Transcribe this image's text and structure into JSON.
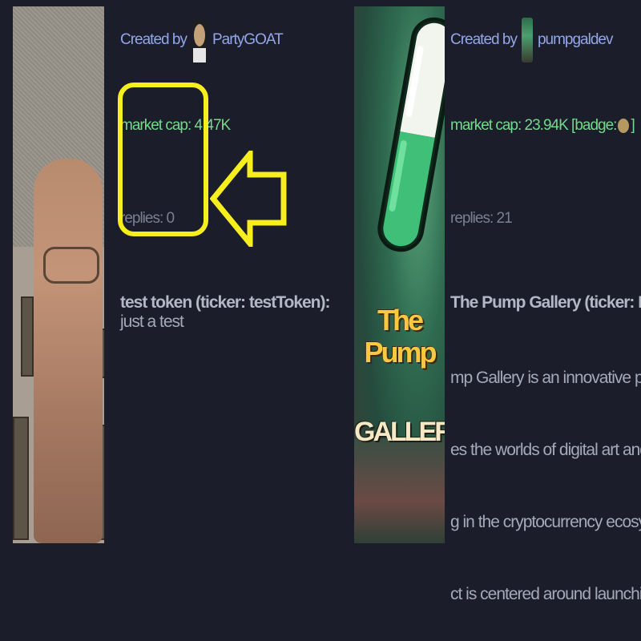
{
  "card1": {
    "created_label": "Created by",
    "creator": "PartyGOAT",
    "market_cap": "market cap: 4.47K",
    "replies": "replies: 0",
    "token_title": "test token (ticker: testToken):",
    "description": "just a test",
    "highlight_color": "#f7ef1d"
  },
  "card2": {
    "created_label": "Created by",
    "creator": "pumpgaldev",
    "market_cap": "market cap: 23.94K",
    "badge_prefix": "[badge:",
    "badge_suffix": "]",
    "replies": "replies: 21",
    "token_title": "The Pump Gallery (ticker: PUMPGAL): T",
    "description_lines": [
      "mp Gallery is an innovative platform that",
      "es the worlds of digital art and digital ma",
      "g in the cryptocurrency ecosystem. This",
      "ct is centered around launching a token"
    ],
    "image_title": "The Pump",
    "image_subtitle": "GALLERY"
  },
  "colors": {
    "background": "#1b1d2a",
    "link": "#93a6e8",
    "market_cap": "#74d98c",
    "muted": "#7b7f92"
  }
}
